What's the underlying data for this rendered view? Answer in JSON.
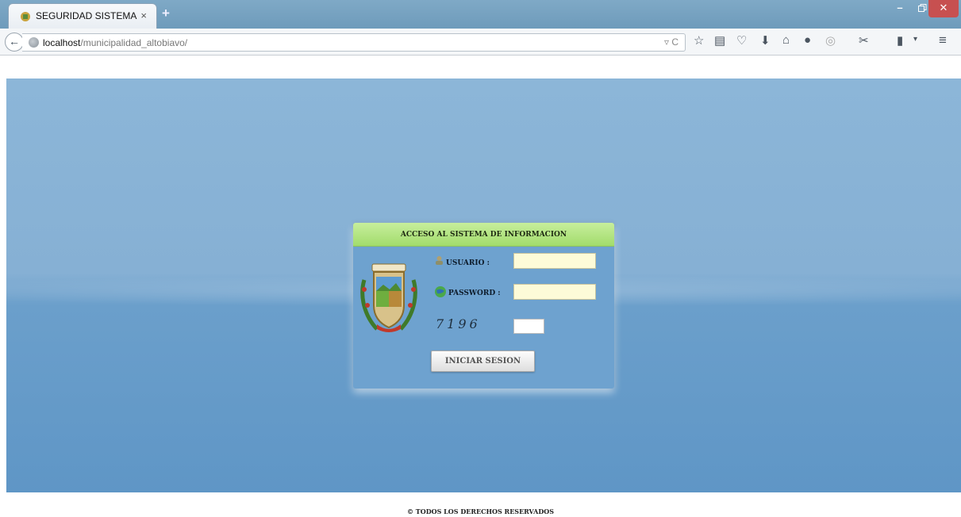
{
  "browser": {
    "tab_title": "SEGURIDAD SISTEMA",
    "tab_close": "×",
    "new_tab": "+",
    "url_host": "localhost",
    "url_path": "/municipalidad_altobiavo/",
    "url_right": "▿ C",
    "window_min": "–",
    "window_max": "🗗",
    "window_close": "✕",
    "back": "←",
    "toolbar_icons": [
      "star-icon",
      "bookmarks-icon",
      "pocket-icon",
      "download-icon",
      "home-icon",
      "chat-icon",
      "sync-icon",
      "tools-icon",
      "battery-icon",
      "menu-icon"
    ]
  },
  "login": {
    "header": "ACCESO AL SISTEMA DE INFORMACION",
    "usuario_label": "USUARIO :",
    "password_label": "PASSWORD :",
    "usuario_value": "",
    "password_value": "",
    "captcha_code": "7196",
    "captcha_value": "",
    "submit_label": "INICIAR SESION"
  },
  "footer": {
    "text": "© TODOS LOS DERECHOS RESERVADOS"
  },
  "colors": {
    "header_green": "#a2dc6c",
    "page_blue": "#6b9fcb",
    "input_yellow": "#fdfbd8"
  }
}
